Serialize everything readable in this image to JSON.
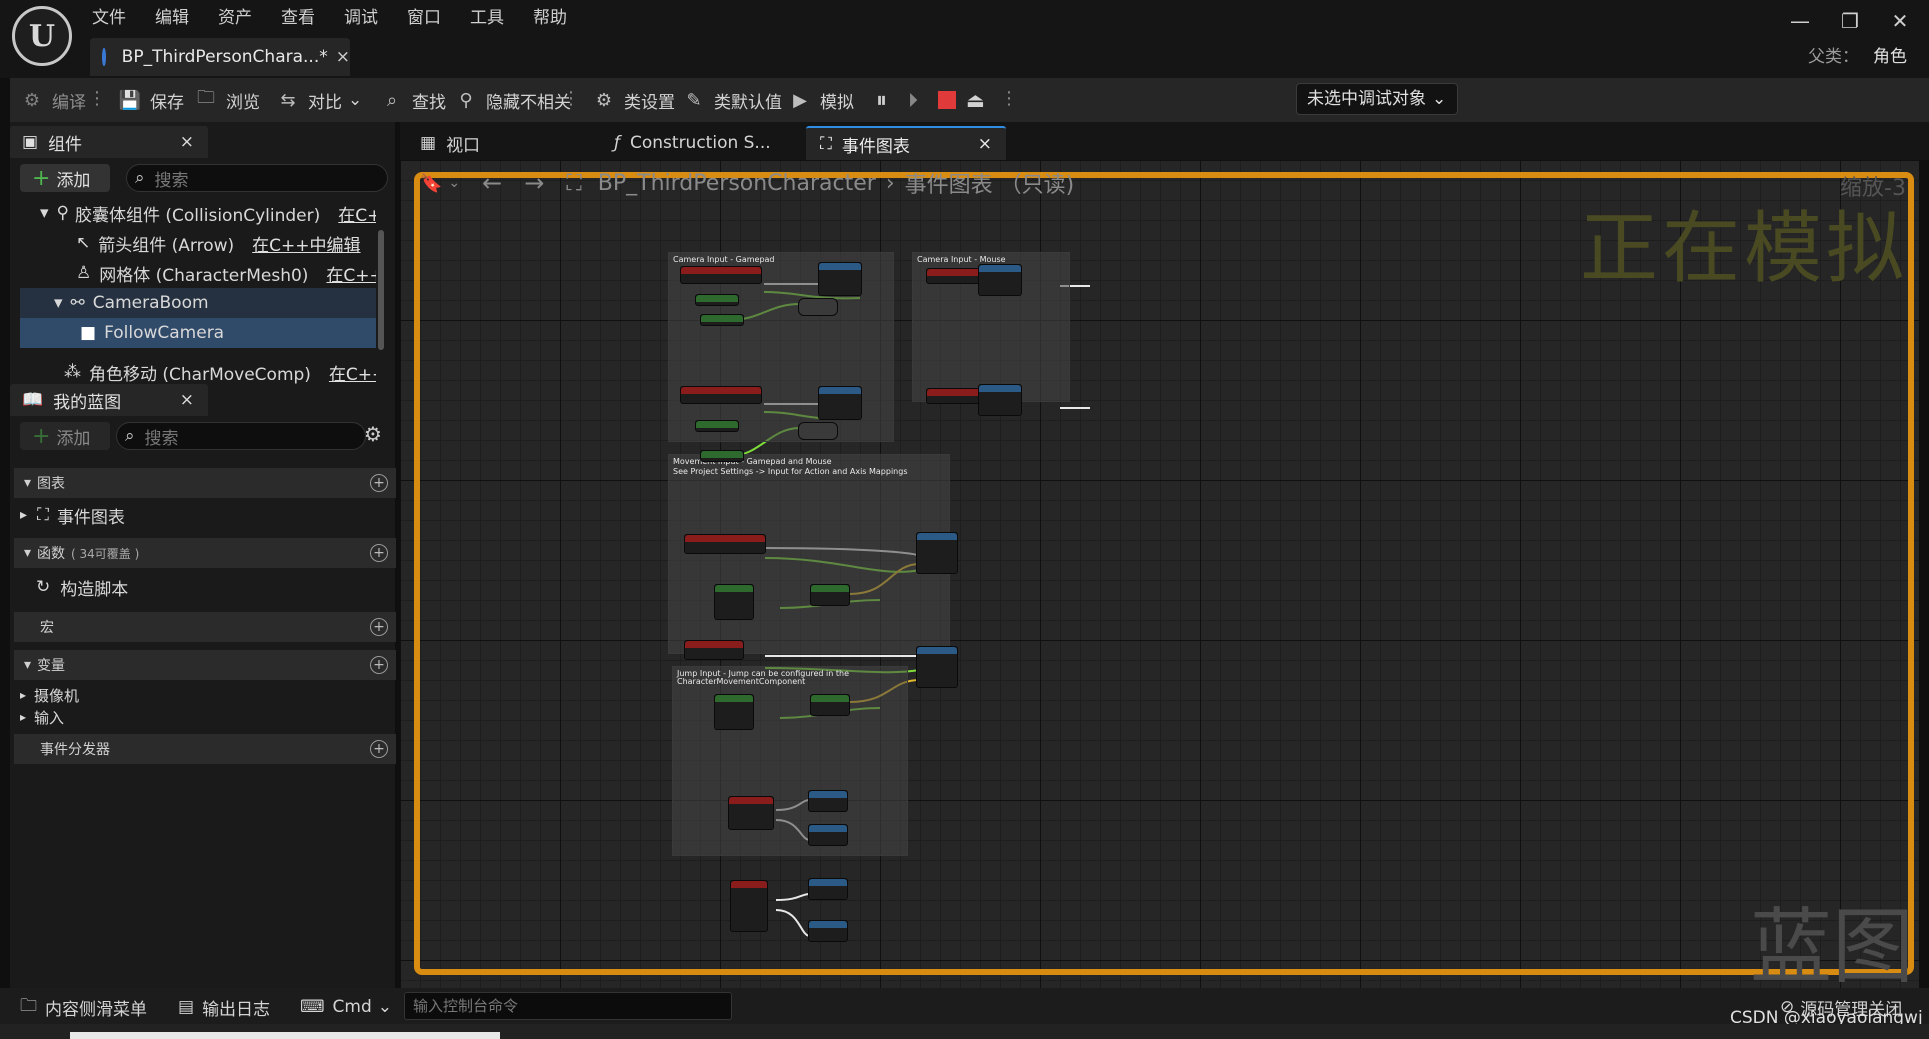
{
  "app": {
    "logo_text": "U",
    "menu": [
      "文件",
      "编辑",
      "资产",
      "查看",
      "调试",
      "窗口",
      "工具",
      "帮助"
    ],
    "window_controls": [
      "—",
      "❐",
      "✕"
    ]
  },
  "doc_tab": {
    "title": "BP_ThirdPersonChara...*",
    "close": "×"
  },
  "parent_class": {
    "label": "父类：",
    "value": "角色"
  },
  "toolbar": {
    "compile": "编译",
    "save": "保存",
    "browse": "浏览",
    "diff": "对比",
    "find": "查找",
    "hide_unrelated": "隐藏不相关",
    "class_settings": "类设置",
    "class_defaults": "类默认值",
    "simulate": "模拟",
    "debug_object": "未选中调试对象"
  },
  "components_panel": {
    "title": "组件",
    "close": "×",
    "add": "添加",
    "search_placeholder": "搜索",
    "items": [
      {
        "label": "胶囊体组件 (CollisionCylinder)",
        "suffix": "在C++"
      },
      {
        "label": "箭头组件 (Arrow)",
        "suffix": "在C++中编辑"
      },
      {
        "label": "网格体 (CharacterMesh0)",
        "suffix": "在C++中编"
      },
      {
        "label": "CameraBoom",
        "suffix": ""
      },
      {
        "label": "FollowCamera",
        "suffix": ""
      },
      {
        "label": "角色移动 (CharMoveComp)",
        "suffix": "在C++中"
      }
    ]
  },
  "my_blueprint": {
    "title": "我的蓝图",
    "close": "×",
    "add": "添加",
    "search_placeholder": "搜索",
    "graphs_label": "图表",
    "event_graph": "事件图表",
    "functions_label": "函数",
    "functions_overridable": "( 34可覆盖 )",
    "construction_script": "构造脚本",
    "macros_label": "宏",
    "variables_label": "变量",
    "var_camera": "摄像机",
    "var_input": "输入",
    "dispatchers_label": "事件分发器"
  },
  "editor_tabs": [
    {
      "label": "视口"
    },
    {
      "label": "Construction S..."
    },
    {
      "label": "事件图表",
      "close": "×"
    }
  ],
  "graph": {
    "breadcrumb_root": "BP_ThirdPersonCharacter",
    "breadcrumb_sep": "›",
    "breadcrumb_leaf": "事件图表 （只读)",
    "zoom": "缩放-3",
    "simulating_watermark": "正在模拟",
    "blueprint_watermark": "蓝图",
    "comments": [
      "Camera Input - Gamepad",
      "Camera Input - Mouse",
      "Movement Input - Gamepad and Mouse",
      "See Project Settings -> Input for Action and Axis Mappings",
      "Jump Input - Jump can be configured in the",
      "CharacterMovementComponent"
    ]
  },
  "statusbar": {
    "content_drawer": "内容侧滑菜单",
    "output_log": "输出日志",
    "cmd": "Cmd",
    "console_placeholder": "输入控制台命令",
    "source_control": "源码管理关闭"
  },
  "watermark_csdn": "CSDN @xiaoyaolangwj",
  "colors": {
    "accent": "#d98c12",
    "selection": "#304a6a",
    "tab_active": "#2f8de4"
  }
}
